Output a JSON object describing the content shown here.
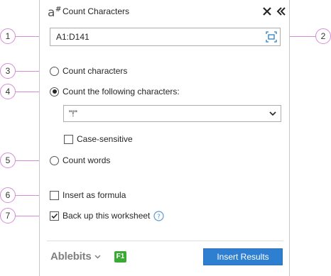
{
  "panel": {
    "title": "Count Characters",
    "icons": {
      "logo": "ablebits-a-icon",
      "close": "close-icon",
      "collapse": "double-chevron-left-icon",
      "select_range": "select-range-icon"
    }
  },
  "range": {
    "value": "A1:D141"
  },
  "options": {
    "count_characters": {
      "label": "Count characters",
      "checked": false
    },
    "count_following": {
      "label": "Count the following characters:",
      "checked": true
    },
    "characters_value": "\"!\"",
    "case_sensitive": {
      "label": "Case-sensitive",
      "checked": false
    },
    "count_words": {
      "label": "Count words",
      "checked": false
    },
    "insert_formula": {
      "label": "Insert as formula",
      "checked": false
    },
    "backup": {
      "label": "Back up this worksheet",
      "checked": true
    }
  },
  "footer": {
    "brand": "Ablebits",
    "f1_label": "F1",
    "insert_button": "Insert Results"
  },
  "callouts": [
    "1",
    "2",
    "3",
    "4",
    "5",
    "6",
    "7"
  ],
  "colors": {
    "accent": "#2f7fd0",
    "callout": "#d58bd8",
    "f1_badge": "#3aaa35",
    "help": "#5b9bd5"
  }
}
